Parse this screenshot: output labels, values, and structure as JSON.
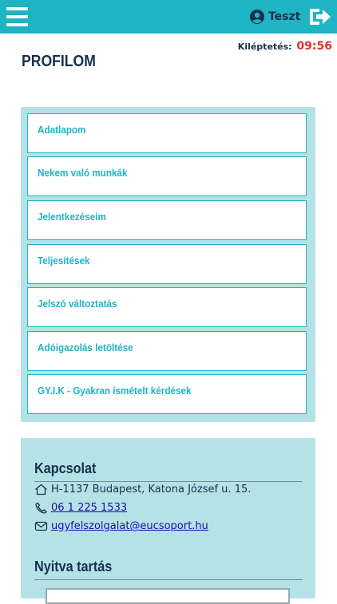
{
  "header": {
    "menu_icon": "hamburger-menu-icon",
    "user_icon": "user-circle-icon",
    "user_name": "Teszt",
    "logout_icon": "logout-arrow-icon"
  },
  "session": {
    "label": "Kiléptetés:",
    "time": "09:56"
  },
  "page": {
    "title": "PROFILOM"
  },
  "menu": {
    "items": [
      {
        "label": "Adatlapom"
      },
      {
        "label": "Nekem való munkák"
      },
      {
        "label": "Jelentkezéseim"
      },
      {
        "label": "Teljesítések"
      },
      {
        "label": "Jelszó változtatás"
      },
      {
        "label": "Adóigazolás letöltése"
      },
      {
        "label": "GY.I.K - Gyakran ismételt kérdések"
      }
    ]
  },
  "contact": {
    "title": "Kapcsolat",
    "address": "H-1137 Budapest, Katona József u. 15.",
    "phone": "06 1 225 1533",
    "email": "ugyfelszolgalat@eucsoport.hu",
    "icons": {
      "address": "home-icon",
      "phone": "phone-icon",
      "email": "envelope-icon"
    }
  },
  "opening": {
    "title": "Nyitva tartás"
  },
  "colors": {
    "accent": "#1fb4c3",
    "panel": "#b5e2e6",
    "dark_text": "#17314d",
    "timer_red": "#e5312e",
    "link": "#1a0dab"
  }
}
